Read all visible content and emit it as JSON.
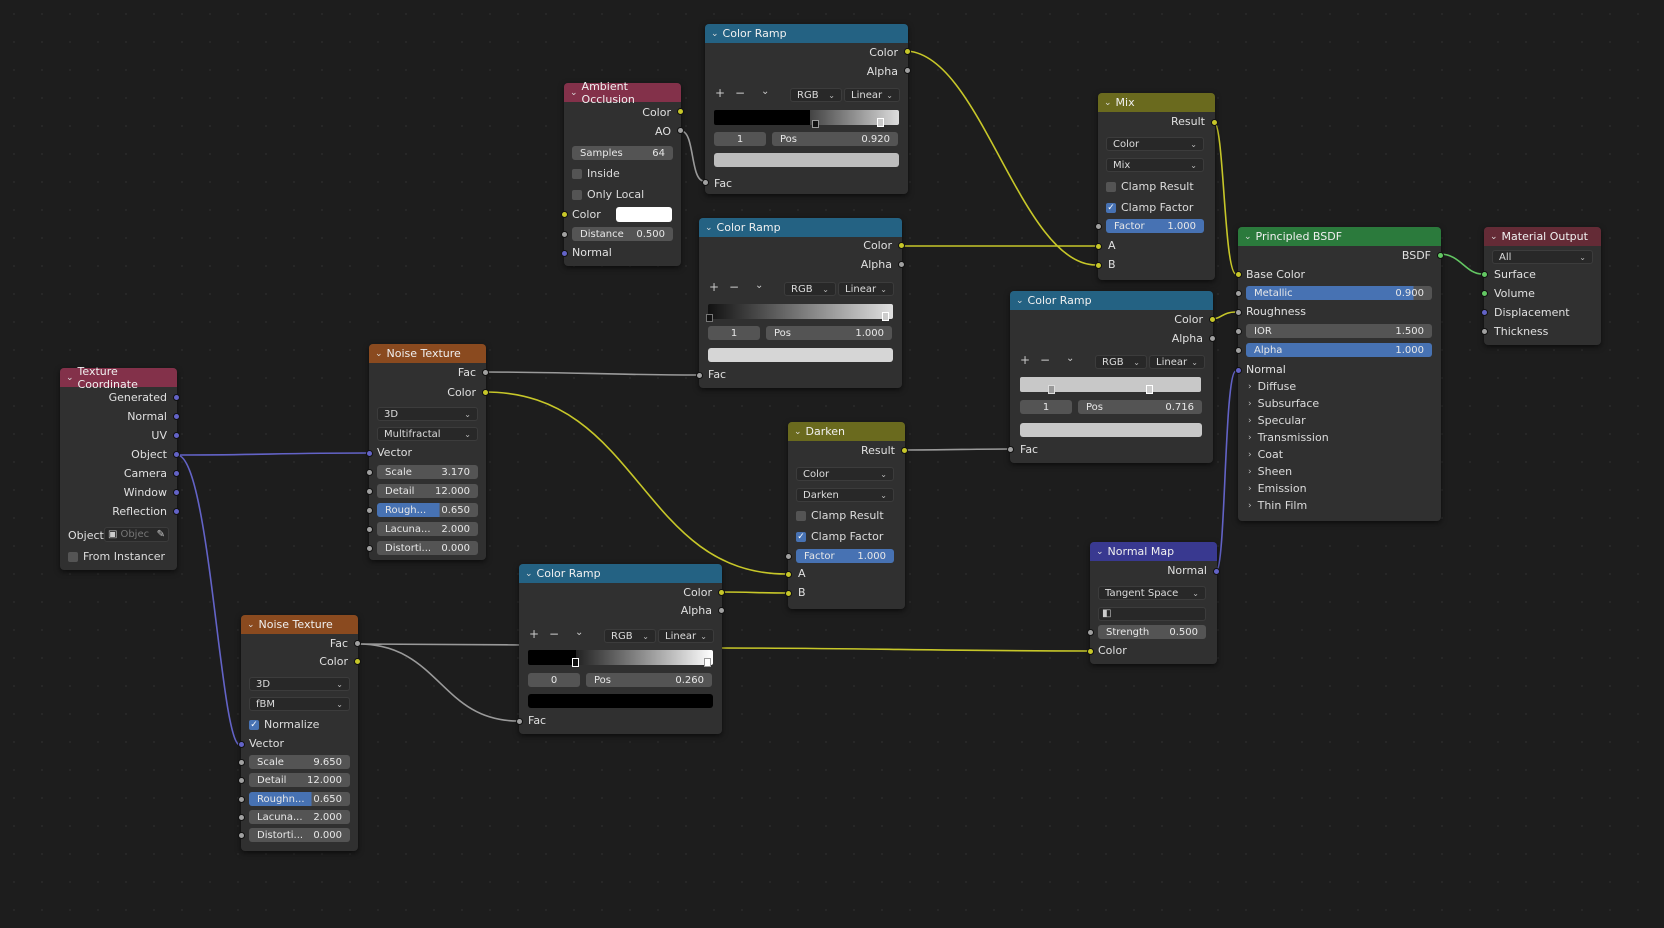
{
  "nodes": {
    "cr1": {
      "title": "Color Ramp",
      "out_color": "Color",
      "out_alpha": "Alpha",
      "mode": "RGB",
      "interp": "Linear",
      "index": "1",
      "pos_label": "Pos",
      "pos": "0.920",
      "in_fac": "Fac"
    },
    "cr2": {
      "title": "Color Ramp",
      "out_color": "Color",
      "out_alpha": "Alpha",
      "mode": "RGB",
      "interp": "Linear",
      "index": "1",
      "pos_label": "Pos",
      "pos": "1.000",
      "in_fac": "Fac"
    },
    "cr3": {
      "title": "Color Ramp",
      "out_color": "Color",
      "out_alpha": "Alpha",
      "mode": "RGB",
      "interp": "Linear",
      "index": "1",
      "pos_label": "Pos",
      "pos": "0.716",
      "in_fac": "Fac"
    },
    "cr4": {
      "title": "Color Ramp",
      "out_color": "Color",
      "out_alpha": "Alpha",
      "mode": "RGB",
      "interp": "Linear",
      "index": "0",
      "pos_label": "Pos",
      "pos": "0.260",
      "in_fac": "Fac"
    },
    "ao": {
      "title": "Ambient Occlusion",
      "out_color": "Color",
      "out_ao": "AO",
      "samples_label": "Samples",
      "samples": "64",
      "inside": "Inside",
      "only_local": "Only Local",
      "in_color": "Color",
      "distance_label": "Distance",
      "distance": "0.500",
      "in_normal": "Normal"
    },
    "mix": {
      "title": "Mix",
      "out_result": "Result",
      "type": "Color",
      "blend": "Mix",
      "clamp_result": "Clamp Result",
      "clamp_factor": "Clamp Factor",
      "factor_label": "Factor",
      "factor": "1.000",
      "in_a": "A",
      "in_b": "B"
    },
    "darken": {
      "title": "Darken",
      "out_result": "Result",
      "type": "Color",
      "blend": "Darken",
      "clamp_result": "Clamp Result",
      "clamp_factor": "Clamp Factor",
      "factor_label": "Factor",
      "factor": "1.000",
      "in_a": "A",
      "in_b": "B"
    },
    "bsdf": {
      "title": "Principled BSDF",
      "out_bsdf": "BSDF",
      "base_color": "Base Color",
      "metallic_label": "Metallic",
      "metallic": "0.900",
      "roughness": "Roughness",
      "ior_label": "IOR",
      "ior": "1.500",
      "alpha_label": "Alpha",
      "alpha": "1.000",
      "normal": "Normal",
      "panels": [
        "Diffuse",
        "Subsurface",
        "Specular",
        "Transmission",
        "Coat",
        "Sheen",
        "Emission",
        "Thin Film"
      ]
    },
    "output": {
      "title": "Material Output",
      "target": "All",
      "surface": "Surface",
      "volume": "Volume",
      "displacement": "Displacement",
      "thickness": "Thickness"
    },
    "texcoord": {
      "title": "Texture Coordinate",
      "outputs": [
        "Generated",
        "Normal",
        "UV",
        "Object",
        "Camera",
        "Window",
        "Reflection"
      ],
      "object_label": "Object:",
      "object_placeholder": "Objec",
      "from_instancer": "From Instancer"
    },
    "noise1": {
      "title": "Noise Texture",
      "out_fac": "Fac",
      "out_color": "Color",
      "dims": "3D",
      "type": "Multifractal",
      "in_vector": "Vector",
      "scale_label": "Scale",
      "scale": "3.170",
      "detail_label": "Detail",
      "detail": "12.000",
      "rough_label": "Rough...",
      "rough": "0.650",
      "lac_label": "Lacuna...",
      "lac": "2.000",
      "dist_label": "Distorti...",
      "dist": "0.000"
    },
    "noise2": {
      "title": "Noise Texture",
      "out_fac": "Fac",
      "out_color": "Color",
      "dims": "3D",
      "type": "fBM",
      "normalize": "Normalize",
      "in_vector": "Vector",
      "scale_label": "Scale",
      "scale": "9.650",
      "detail_label": "Detail",
      "detail": "12.000",
      "rough_label": "Roughn...",
      "rough": "0.650",
      "lac_label": "Lacuna...",
      "lac": "2.000",
      "dist_label": "Distorti...",
      "dist": "0.000"
    },
    "normalmap": {
      "title": "Normal Map",
      "out_normal": "Normal",
      "space": "Tangent Space",
      "strength_label": "Strength",
      "strength": "0.500",
      "in_color": "Color"
    }
  },
  "colors": {
    "yellow": "#c7c729",
    "grey": "#a1a1a1",
    "purple": "#6363c7",
    "green": "#63c763",
    "link_yellow": "#c7c729",
    "link_grey": "#9a9a9a",
    "link_purple": "#6363c7",
    "link_green": "#63c763"
  }
}
